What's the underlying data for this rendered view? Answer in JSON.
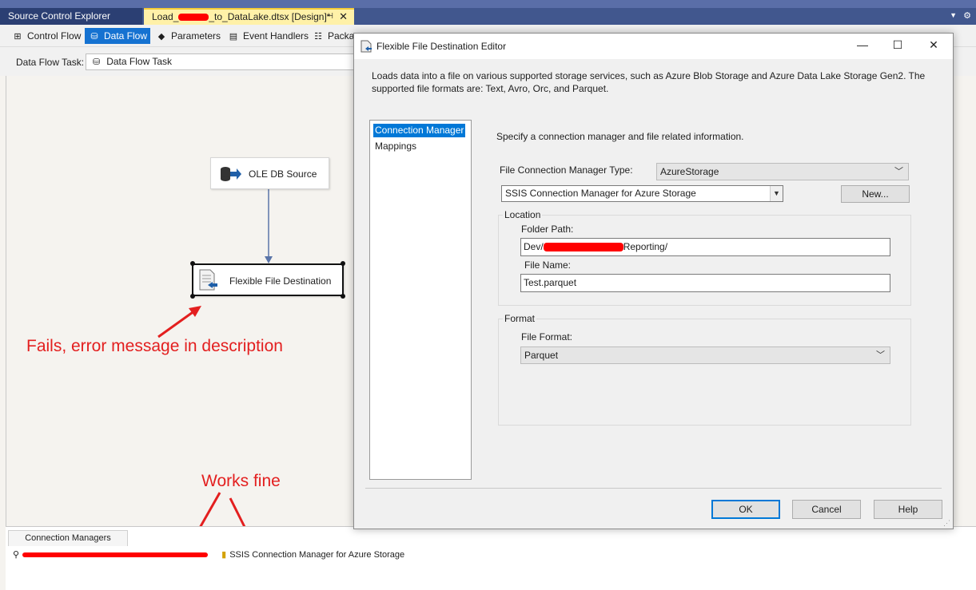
{
  "tabs": {
    "source_control": "Source Control Explorer",
    "package_prefix": "Load_",
    "package_suffix": "_to_DataLake.dtsx [Design]*",
    "pin": "⊣",
    "close": "✕"
  },
  "designer_tabs": [
    {
      "label": "Control Flow"
    },
    {
      "label": "Data Flow"
    },
    {
      "label": "Parameters"
    },
    {
      "label": "Event Handlers"
    },
    {
      "label": "Packag"
    }
  ],
  "data_flow_task": {
    "label": "Data Flow Task:",
    "value": "Data Flow Task"
  },
  "components": {
    "ole_source": "OLE DB Source",
    "ffd": "Flexible File Destination"
  },
  "annotations": {
    "fails": "Fails, error message in description",
    "works": "Works fine"
  },
  "connection_managers": {
    "tab": "Connection Managers",
    "item2": "SSIS Connection Manager for Azure Storage"
  },
  "dialog": {
    "title": "Flexible File Destination Editor",
    "description": "Loads data into a file on various supported storage services, such as Azure Blob Storage and Azure Data Lake Storage Gen2. The supported file formats are: Text, Avro, Orc, and Parquet.",
    "nav": [
      "Connection Manager",
      "Mappings"
    ],
    "specify": "Specify a connection manager and file related information.",
    "fcm_type_label": "File Connection Manager Type:",
    "fcm_type_value": "AzureStorage",
    "connection_value": "SSIS Connection Manager for Azure Storage",
    "new_button": "New...",
    "location_group": "Location",
    "folder_path_label": "Folder Path:",
    "folder_path_prefix": "Dev/",
    "folder_path_suffix": "Reporting/",
    "file_name_label": "File Name:",
    "file_name_value": "Test.parquet",
    "format_group": "Format",
    "file_format_label": "File Format:",
    "file_format_value": "Parquet",
    "ok": "OK",
    "cancel": "Cancel",
    "help": "Help"
  }
}
